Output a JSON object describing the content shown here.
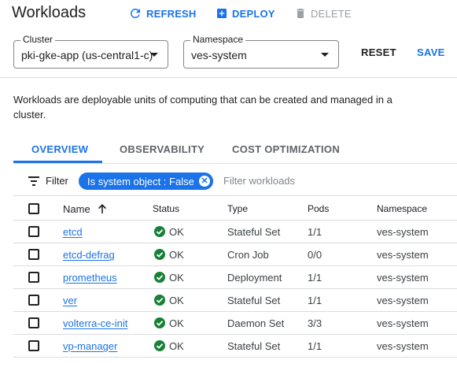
{
  "header": {
    "title": "Workloads",
    "refresh_label": "REFRESH",
    "deploy_label": "DEPLOY",
    "delete_label": "DELETE"
  },
  "controls": {
    "cluster_label": "Cluster",
    "cluster_value": "pki-gke-app (us-central1-c)",
    "namespace_label": "Namespace",
    "namespace_value": "ves-system",
    "reset_label": "RESET",
    "save_label": "SAVE"
  },
  "description": "Workloads are deployable units of computing that can be created and managed in a cluster.",
  "tabs": [
    {
      "label": "OVERVIEW",
      "active": true
    },
    {
      "label": "OBSERVABILITY",
      "active": false
    },
    {
      "label": "COST OPTIMIZATION",
      "active": false
    }
  ],
  "filter": {
    "label": "Filter",
    "chip": "Is system object : False",
    "placeholder": "Filter workloads"
  },
  "table": {
    "headers": [
      "Name",
      "Status",
      "Type",
      "Pods",
      "Namespace"
    ],
    "rows": [
      {
        "name": "etcd",
        "status": "OK",
        "type": "Stateful Set",
        "pods": "1/1",
        "namespace": "ves-system"
      },
      {
        "name": "etcd-defrag",
        "status": "OK",
        "type": "Cron Job",
        "pods": "0/0",
        "namespace": "ves-system"
      },
      {
        "name": "prometheus",
        "status": "OK",
        "type": "Deployment",
        "pods": "1/1",
        "namespace": "ves-system"
      },
      {
        "name": "ver",
        "status": "OK",
        "type": "Stateful Set",
        "pods": "1/1",
        "namespace": "ves-system"
      },
      {
        "name": "volterra-ce-init",
        "status": "OK",
        "type": "Daemon Set",
        "pods": "3/3",
        "namespace": "ves-system"
      },
      {
        "name": "vp-manager",
        "status": "OK",
        "type": "Stateful Set",
        "pods": "1/1",
        "namespace": "ves-system"
      }
    ]
  },
  "colors": {
    "accent": "#1a73e8",
    "ok": "#188038",
    "divider": "#dadce0"
  }
}
